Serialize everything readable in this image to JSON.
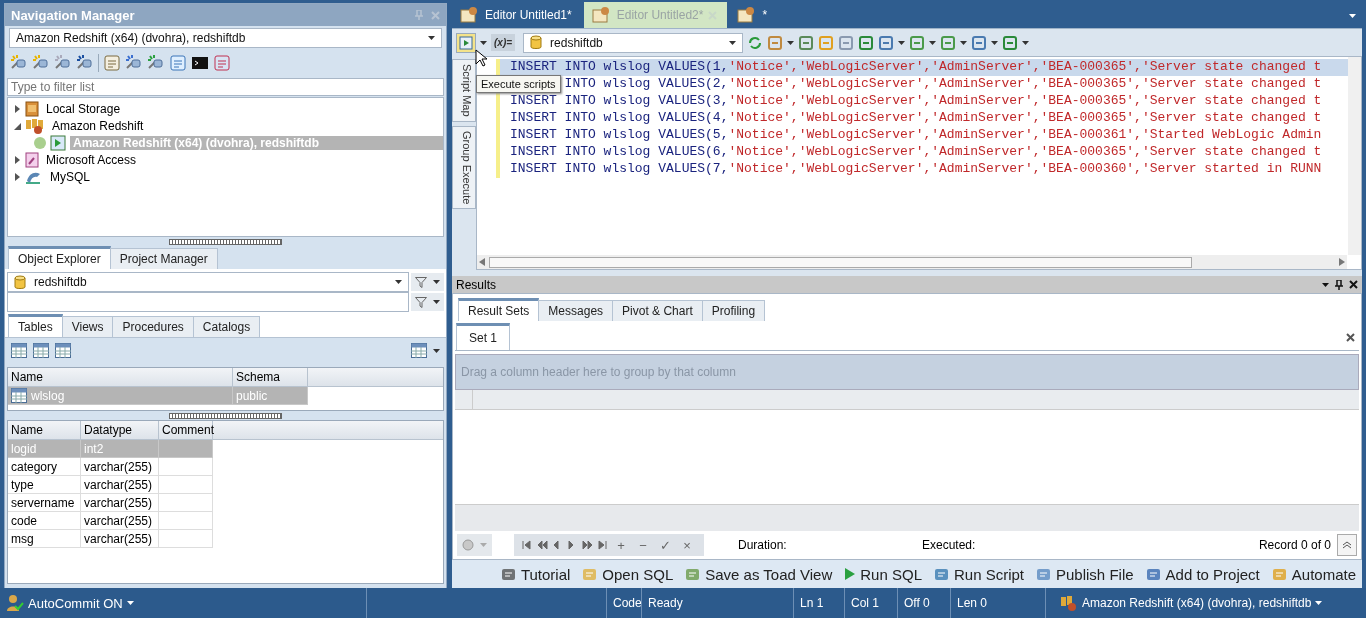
{
  "nav": {
    "title": "Navigation Manager",
    "connection": "Amazon Redshift (x64) (dvohra), redshiftdb",
    "filter_placeholder": "Type to filter list",
    "tree": [
      {
        "label": "Local Storage",
        "expanded": false,
        "selected": false
      },
      {
        "label": "Amazon Redshift",
        "expanded": true,
        "selected": false,
        "children": [
          {
            "label": "Amazon Redshift (x64) (dvohra), redshiftdb",
            "selected": true,
            "connected": true
          }
        ]
      },
      {
        "label": "Microsoft Access",
        "expanded": false,
        "selected": false
      },
      {
        "label": "MySQL",
        "expanded": false,
        "selected": false
      }
    ]
  },
  "explorer": {
    "tabs": [
      {
        "label": "Object Explorer",
        "selected": true
      },
      {
        "label": "Project Manager",
        "selected": false
      }
    ],
    "database": "redshiftdb",
    "object_tabs": [
      {
        "label": "Tables",
        "selected": true
      },
      {
        "label": "Views",
        "selected": false
      },
      {
        "label": "Procedures",
        "selected": false
      },
      {
        "label": "Catalogs",
        "selected": false
      }
    ],
    "objects": {
      "columns": [
        "Name",
        "Schema"
      ],
      "rows": [
        {
          "cells": [
            "wlslog",
            "public"
          ],
          "selected": true
        }
      ]
    },
    "columns_grid": {
      "columns": [
        "Name",
        "Datatype",
        "Comment"
      ],
      "rows": [
        {
          "cells": [
            "logid",
            "int2"
          ],
          "selected": true
        },
        {
          "cells": [
            "category",
            "varchar(255)"
          ],
          "selected": false
        },
        {
          "cells": [
            "type",
            "varchar(255)"
          ],
          "selected": false
        },
        {
          "cells": [
            "servername",
            "varchar(255)"
          ],
          "selected": false
        },
        {
          "cells": [
            "code",
            "varchar(255)"
          ],
          "selected": false
        },
        {
          "cells": [
            "msg",
            "varchar(255)"
          ],
          "selected": false
        }
      ]
    }
  },
  "editor": {
    "tabs": [
      {
        "label": "Editor Untitled1*",
        "selected": false
      },
      {
        "label": "Editor Untitled2*",
        "selected": true
      },
      {
        "label": "*",
        "selected": false
      }
    ],
    "variables_label": "(x)=",
    "database": "redshiftdb",
    "tooltip": "Execute scripts",
    "side_tabs": [
      "Script Map",
      "Group Execute"
    ],
    "lines": [
      {
        "selected": true,
        "covered": false,
        "segments": [
          {
            "kind": "kw",
            "text": "INSERT INTO wlslog VALUES(1,"
          },
          {
            "kind": "str",
            "text": "'Notice','WebLogicServer','AdminServer','BEA-000365','Server state changed t"
          }
        ]
      },
      {
        "selected": false,
        "covered": true,
        "segments": [
          {
            "kind": "kw",
            "text": "INTO wlslog VALUES(2,"
          },
          {
            "kind": "str",
            "text": "'Notice','WebLogicServer','AdminServer','BEA-000365','Server state changed t"
          }
        ]
      },
      {
        "selected": false,
        "covered": false,
        "segments": [
          {
            "kind": "kw",
            "text": "INSERT INTO wlslog VALUES(3,"
          },
          {
            "kind": "str",
            "text": "'Notice','WebLogicServer','AdminServer','BEA-000365','Server state changed t"
          }
        ]
      },
      {
        "selected": false,
        "covered": false,
        "segments": [
          {
            "kind": "kw",
            "text": "INSERT INTO wlslog VALUES(4,"
          },
          {
            "kind": "str",
            "text": "'Notice','WebLogicServer','AdminServer','BEA-000365','Server state changed t"
          }
        ]
      },
      {
        "selected": false,
        "covered": false,
        "segments": [
          {
            "kind": "kw",
            "text": "INSERT INTO wlslog VALUES(5,"
          },
          {
            "kind": "str",
            "text": "'Notice','WebLogicServer','AdminServer','BEA-000361','Started WebLogic Admin"
          }
        ]
      },
      {
        "selected": false,
        "covered": false,
        "segments": [
          {
            "kind": "kw",
            "text": "INSERT INTO wlslog VALUES(6,"
          },
          {
            "kind": "str",
            "text": "'Notice','WebLogicServer','AdminServer','BEA-000365','Server state changed t"
          }
        ]
      },
      {
        "selected": false,
        "covered": false,
        "segments": [
          {
            "kind": "kw",
            "text": "INSERT INTO wlslog VALUES(7,"
          },
          {
            "kind": "str",
            "text": "'Notice','WebLogicServer','AdminServer','BEA-000360','Server started in RUNN"
          }
        ]
      }
    ]
  },
  "results": {
    "title": "Results",
    "tabs": [
      {
        "label": "Result Sets",
        "selected": true
      },
      {
        "label": "Messages",
        "selected": false
      },
      {
        "label": "Pivot & Chart",
        "selected": false
      },
      {
        "label": "Profiling",
        "selected": false
      }
    ],
    "set_tabs": [
      {
        "label": "Set 1",
        "selected": true
      }
    ],
    "group_hint": "Drag a column header here to group by that column",
    "edit_buttons": [
      "+",
      "−",
      "✓",
      "×"
    ],
    "duration_label": "Duration:",
    "executed_label": "Executed:",
    "record": "Record 0 of 0"
  },
  "quick_bar": [
    "Tutorial",
    "Open SQL",
    "Save as Toad View",
    "Run SQL",
    "Run Script",
    "Publish File",
    "Add to Project",
    "Automate"
  ],
  "status_bar": {
    "autocommit": "AutoCommit ON",
    "fields": [
      "Code",
      "Ready",
      "Ln 1",
      "Col 1",
      "Off 0",
      "Len 0"
    ],
    "connection": "Amazon Redshift (x64) (dvohra), redshiftdb"
  }
}
